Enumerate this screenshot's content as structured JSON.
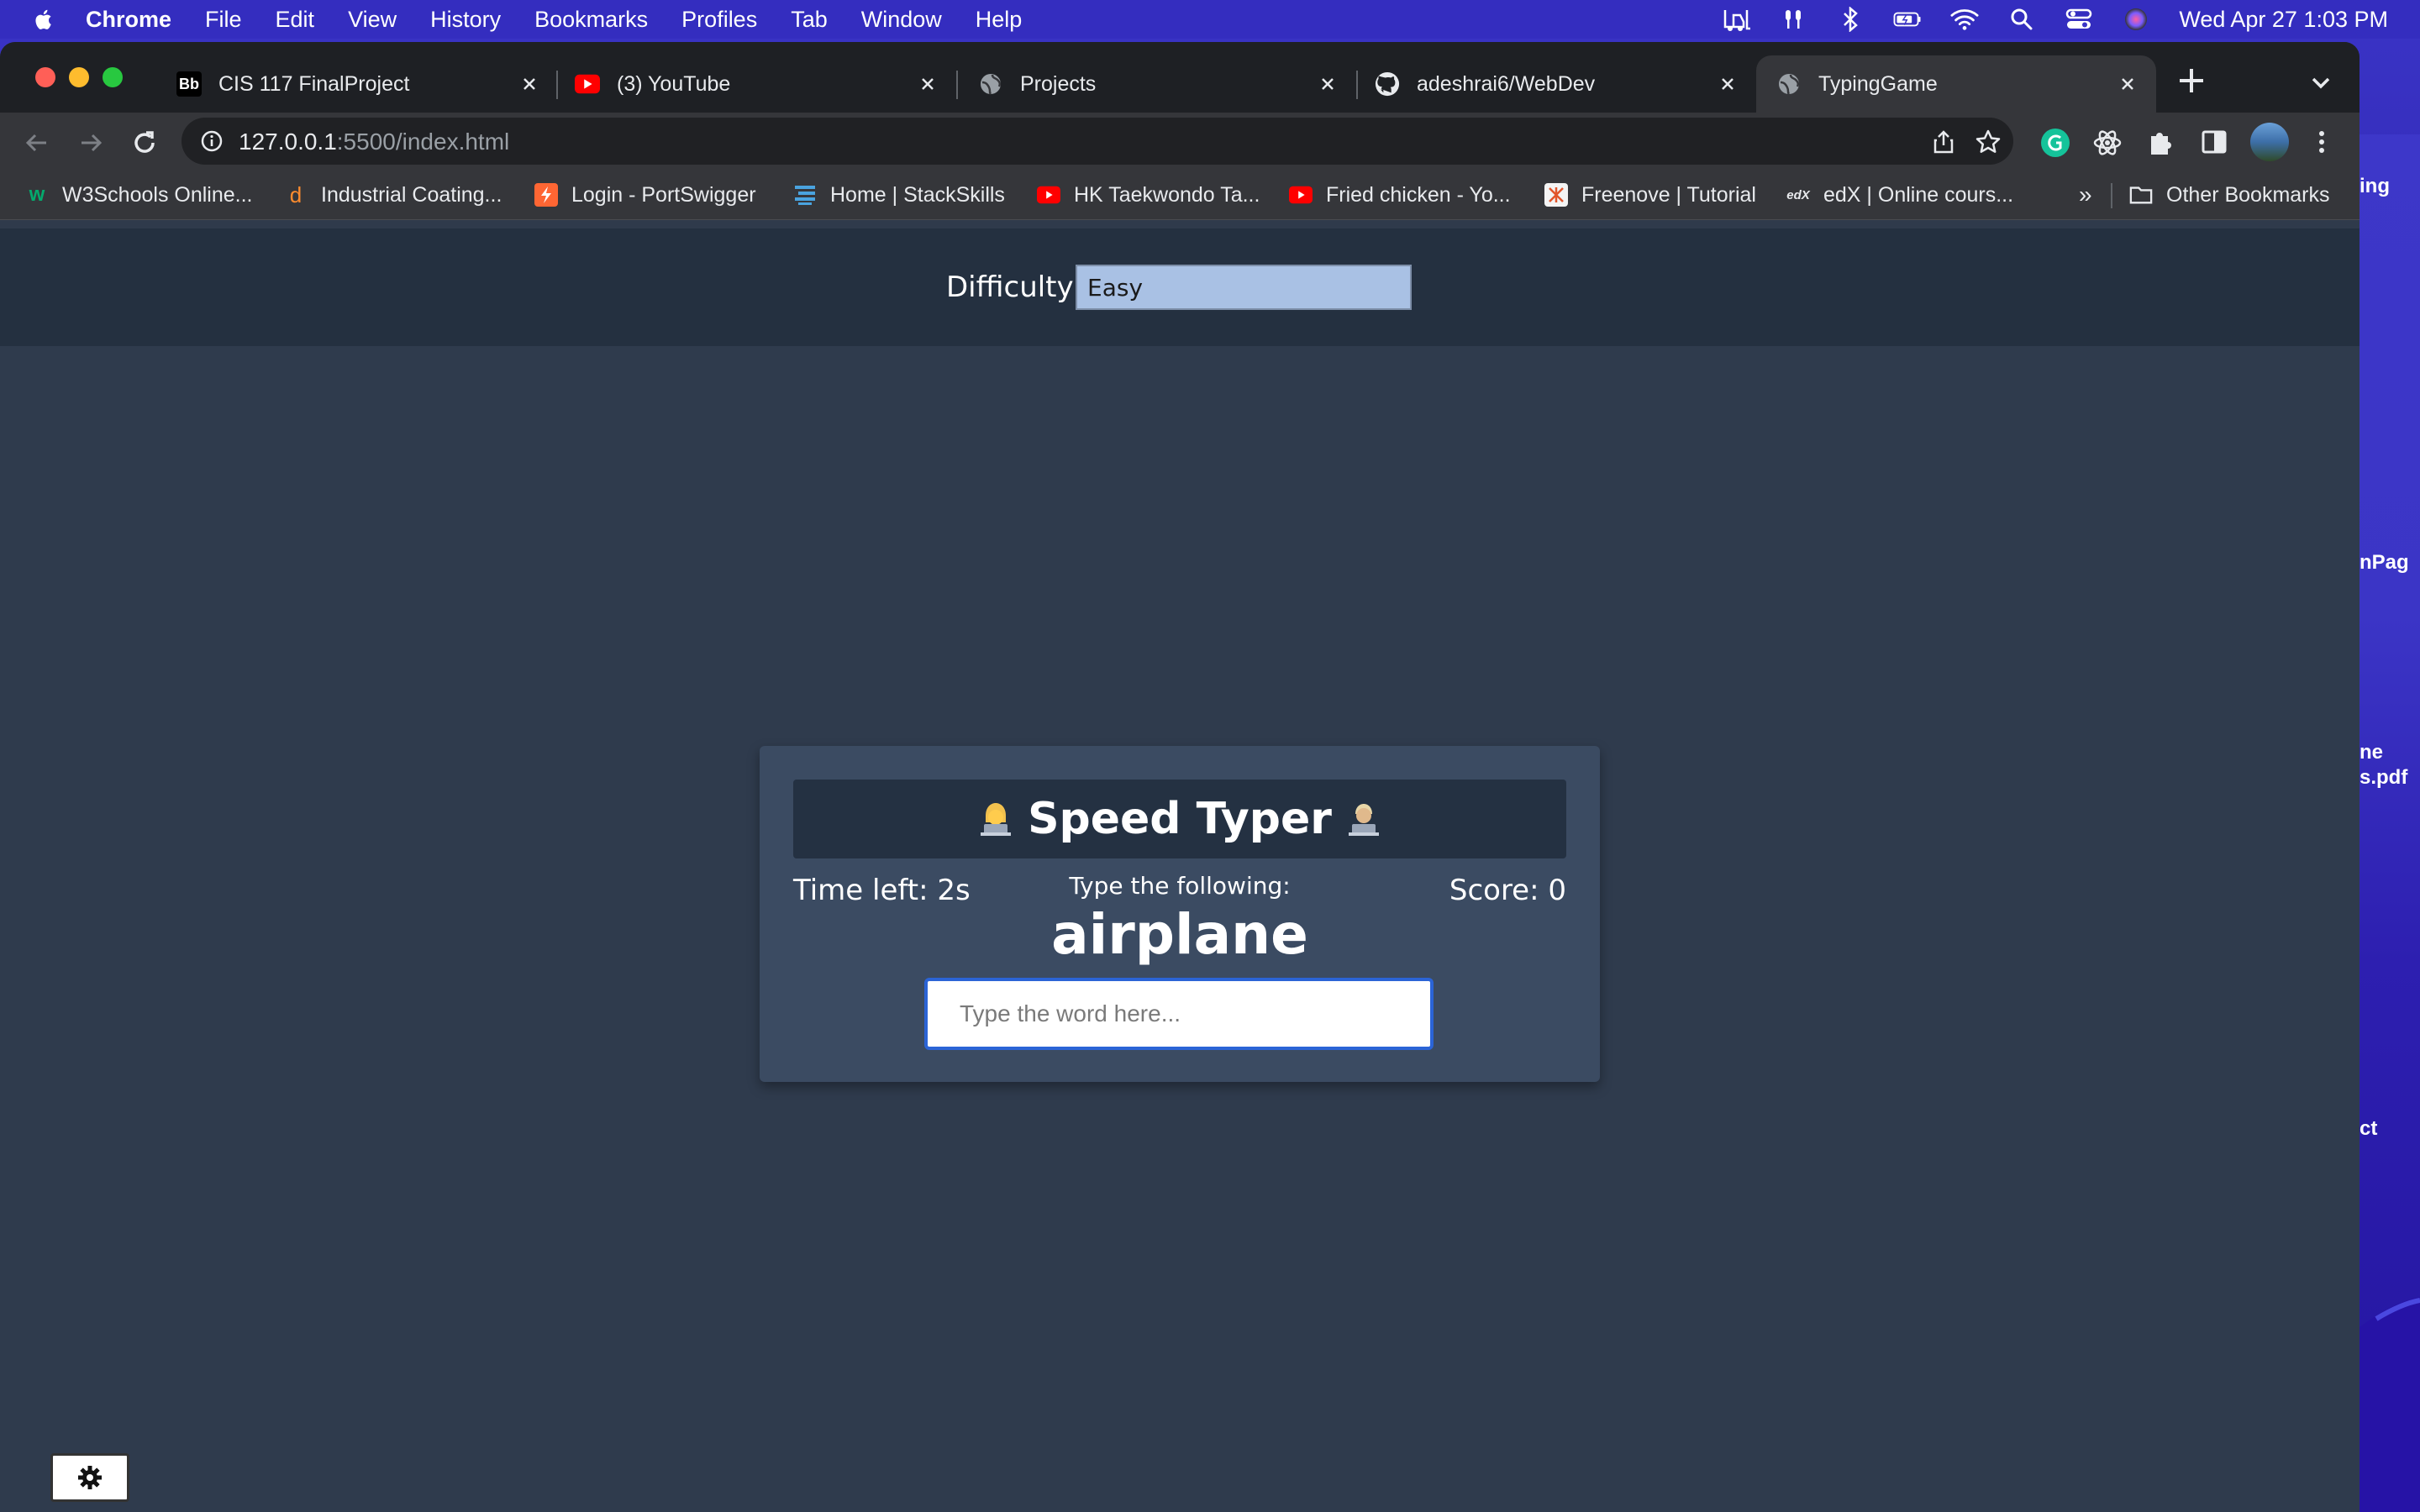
{
  "menubar": {
    "app_name": "Chrome",
    "items": [
      "File",
      "Edit",
      "View",
      "History",
      "Bookmarks",
      "Profiles",
      "Tab",
      "Window",
      "Help"
    ],
    "clock": "Wed Apr 27  1:03 PM"
  },
  "desktop": {
    "labels": [
      "ing",
      "nPag",
      "ne",
      "s.pdf",
      "ct"
    ]
  },
  "tabs": [
    {
      "title": "CIS 117 FinalProject",
      "icon": "blackboard-icon"
    },
    {
      "title": "(3) YouTube",
      "icon": "youtube-icon"
    },
    {
      "title": "Projects",
      "icon": "globe-icon"
    },
    {
      "title": "adeshrai6/WebDev",
      "icon": "github-icon"
    },
    {
      "title": "TypingGame",
      "icon": "globe-icon",
      "active": true
    }
  ],
  "toolbar": {
    "url_host": "127.0.0.1",
    "url_rest": ":5500/index.html"
  },
  "bookmarks": {
    "items": [
      {
        "label": "W3Schools Online...",
        "icon": "w3schools-icon"
      },
      {
        "label": "Industrial Coating...",
        "icon": "d-icon"
      },
      {
        "label": "Login - PortSwigger",
        "icon": "portswigger-icon"
      },
      {
        "label": "Home | StackSkills",
        "icon": "stackskills-icon"
      },
      {
        "label": "HK Taekwondo Ta...",
        "icon": "youtube-icon"
      },
      {
        "label": "Fried chicken - Yo...",
        "icon": "youtube-icon"
      },
      {
        "label": "Freenove | Tutorial",
        "icon": "freenove-icon"
      },
      {
        "label": "edX | Online cours...",
        "icon": "edx-icon"
      }
    ],
    "overflow": "»",
    "other": "Other Bookmarks"
  },
  "game": {
    "difficulty_label": "Difficulty",
    "difficulty_value": "Easy",
    "title": "Speed Typer",
    "time_left": "Time left: 2s",
    "prompt_label": "Type the following:",
    "word": "airplane",
    "score": "Score: 0",
    "input_placeholder": "Type the word here..."
  },
  "colors": {
    "page_bg": "#2f3b4d",
    "header_bg": "#243040",
    "card_bg": "#3b4b62",
    "select_bg": "#a9c1e4",
    "input_focus": "#2b64d6"
  }
}
